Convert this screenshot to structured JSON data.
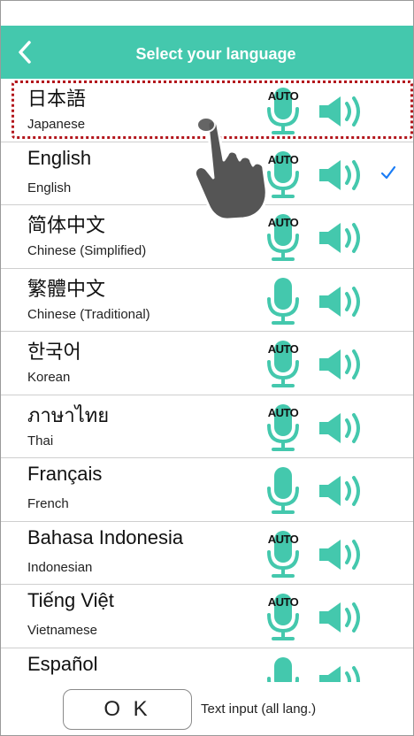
{
  "header": {
    "title": "Select your language",
    "back_icon": "chevron-left-icon"
  },
  "colors": {
    "accent": "#44c8ad",
    "highlight": "#b3161c",
    "check": "#1a7cf5"
  },
  "languages": [
    {
      "native": "日本語",
      "english": "Japanese",
      "mic_label": "AUTO",
      "auto": true,
      "selected": false
    },
    {
      "native": "English",
      "english": "English",
      "mic_label": "AUTO",
      "auto": true,
      "selected": true
    },
    {
      "native": "简体中文",
      "english": "Chinese (Simplified)",
      "mic_label": "AUTO",
      "auto": true,
      "selected": false
    },
    {
      "native": "繁體中文",
      "english": "Chinese (Traditional)",
      "mic_label": "",
      "auto": false,
      "selected": false
    },
    {
      "native": "한국어",
      "english": "Korean",
      "mic_label": "AUTO",
      "auto": true,
      "selected": false
    },
    {
      "native": "ภาษาไทย",
      "english": "Thai",
      "mic_label": "AUTO",
      "auto": true,
      "selected": false
    },
    {
      "native": "Français",
      "english": "French",
      "mic_label": "",
      "auto": false,
      "selected": false
    },
    {
      "native": "Bahasa Indonesia",
      "english": "Indonesian",
      "mic_label": "AUTO",
      "auto": true,
      "selected": false
    },
    {
      "native": "Tiếng Việt",
      "english": "Vietnamese",
      "mic_label": "AUTO",
      "auto": true,
      "selected": false
    },
    {
      "native": "Español",
      "english": "",
      "mic_label": "",
      "auto": false,
      "selected": false
    }
  ],
  "footer": {
    "ok_label": "O K",
    "text_input_label": "Text input (all lang.)"
  }
}
